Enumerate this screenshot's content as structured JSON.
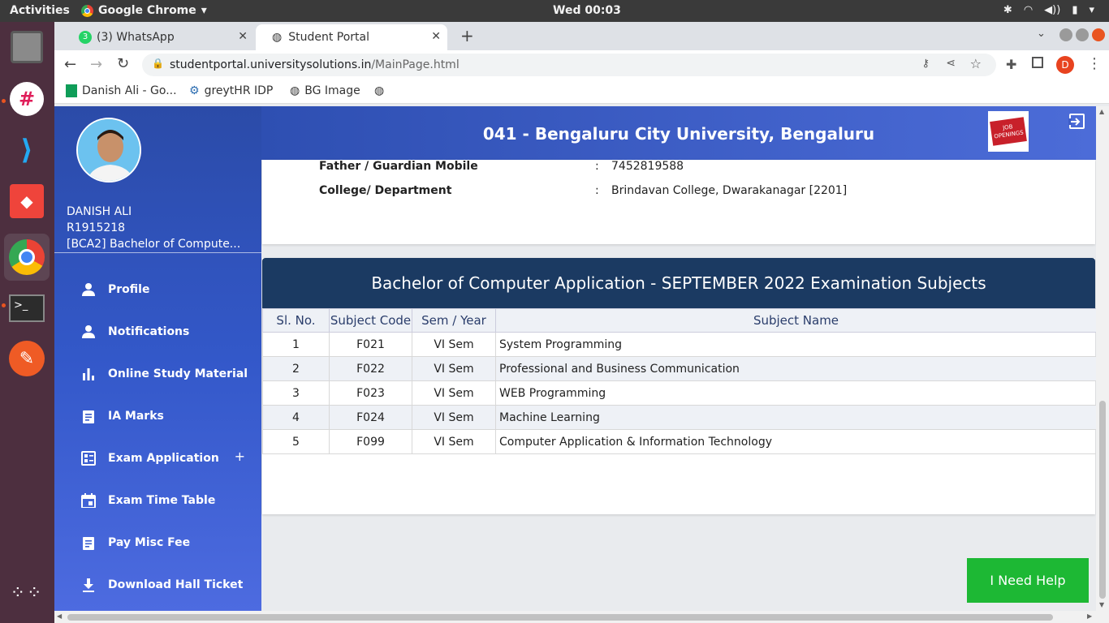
{
  "os": {
    "activities": "Activities",
    "app_name": "Google Chrome",
    "clock": "Wed 00:03"
  },
  "tabs": [
    {
      "label": "(3) WhatsApp",
      "badge": "3"
    },
    {
      "label": "Student Portal"
    }
  ],
  "address": {
    "domain": "studentportal.universitysolutions.in",
    "path": "/MainPage.html",
    "profile_initial": "D"
  },
  "bookmarks": [
    "Danish Ali - Go...",
    "greytHR IDP",
    "BG Image"
  ],
  "user": {
    "name": "DANISH ALI",
    "reg_no": "R1915218",
    "course": "[BCA2] Bachelor of Compute..."
  },
  "menu": [
    {
      "label": "Profile",
      "icon": "person-icon"
    },
    {
      "label": "Notifications",
      "icon": "person-icon"
    },
    {
      "label": "Online Study Material",
      "icon": "bar-chart-icon"
    },
    {
      "label": "IA Marks",
      "icon": "clipboard-icon"
    },
    {
      "label": "Exam Application",
      "icon": "form-icon",
      "expand": "+"
    },
    {
      "label": "Exam Time Table",
      "icon": "calendar-icon"
    },
    {
      "label": "Pay Misc Fee",
      "icon": "clipboard-icon"
    },
    {
      "label": "Download Hall Ticket",
      "icon": "download-icon"
    }
  ],
  "header": {
    "title": "041 - Bengaluru City University, Bengaluru",
    "jobs_text": "JOB OPENINGS"
  },
  "details": [
    {
      "key": "Father / Guardian Mobile",
      "sep": ":",
      "value": "7452819588"
    },
    {
      "key": "College/ Department",
      "sep": ":",
      "value": "Brindavan College, Dwarakanagar [2201]"
    }
  ],
  "subjects": {
    "title": "Bachelor of Computer Application - SEPTEMBER 2022 Examination Subjects",
    "columns": [
      "Sl. No.",
      "Subject Code",
      "Sem / Year",
      "Subject Name"
    ],
    "rows": [
      [
        "1",
        "F021",
        "VI Sem",
        "System Programming"
      ],
      [
        "2",
        "F022",
        "VI Sem",
        "Professional and Business Communication"
      ],
      [
        "3",
        "F023",
        "VI Sem",
        "WEB Programming"
      ],
      [
        "4",
        "F024",
        "VI Sem",
        "Machine Learning"
      ],
      [
        "5",
        "F099",
        "VI Sem",
        "Computer Application & Information Technology"
      ]
    ]
  },
  "help_button": "I Need Help"
}
